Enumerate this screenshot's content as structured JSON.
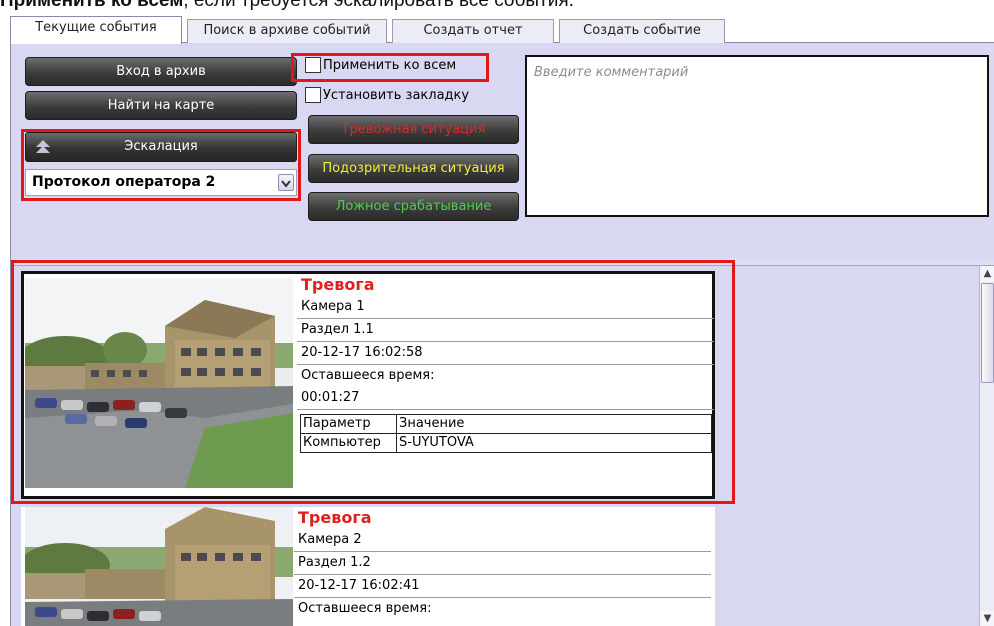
{
  "caption": {
    "bold": "Применить ко всем",
    "rest": ", если требуется эскалировать все события."
  },
  "tabs": [
    {
      "label": "Текущие события",
      "active": true
    },
    {
      "label": "Поиск в архиве событий",
      "active": false
    },
    {
      "label": "Создать отчет",
      "active": false
    },
    {
      "label": "Создать событие",
      "active": false
    }
  ],
  "buttons": {
    "archive": "Вход в архив",
    "map": "Найти на карте",
    "escalation": "Эскалация",
    "alarm": "Тревожная ситуация",
    "suspicious": "Подозрительная ситуация",
    "false_alarm": "Ложное срабатывание"
  },
  "checkboxes": {
    "apply_all": "Применить ко всем",
    "bookmark": "Установить закладку"
  },
  "protocol_select": {
    "value": "Протокол оператора 2"
  },
  "comment": {
    "placeholder": "Введите комментарий"
  },
  "events": [
    {
      "title": "Тревога",
      "camera": "Камера 1",
      "section": "Раздел 1.1",
      "datetime": "20-12-17 16:02:58",
      "remaining_label": "Оставшееся время:",
      "remaining": "00:01:27",
      "table": {
        "headers": [
          "Параметр",
          "Значение"
        ],
        "rows": [
          [
            "Компьютер",
            "S-UYUTOVA"
          ]
        ]
      }
    },
    {
      "title": "Тревога",
      "camera": "Камера 2",
      "section": "Раздел 1.2",
      "datetime": "20-12-17 16:02:41",
      "remaining_label": "Оставшееся время:"
    }
  ],
  "colors": {
    "highlight": "#e01818",
    "alarm_title": "#e11f1f",
    "panel": "#d8d8f2",
    "btn_red": "#e02828",
    "btn_yellow": "#f2ec3a",
    "btn_green": "#48d048"
  },
  "icons": {
    "escalation": "chevron-up-double-icon",
    "dropdown": "chevron-down-icon",
    "scroll_up": "arrow-up-icon",
    "scroll_down": "arrow-down-icon"
  }
}
